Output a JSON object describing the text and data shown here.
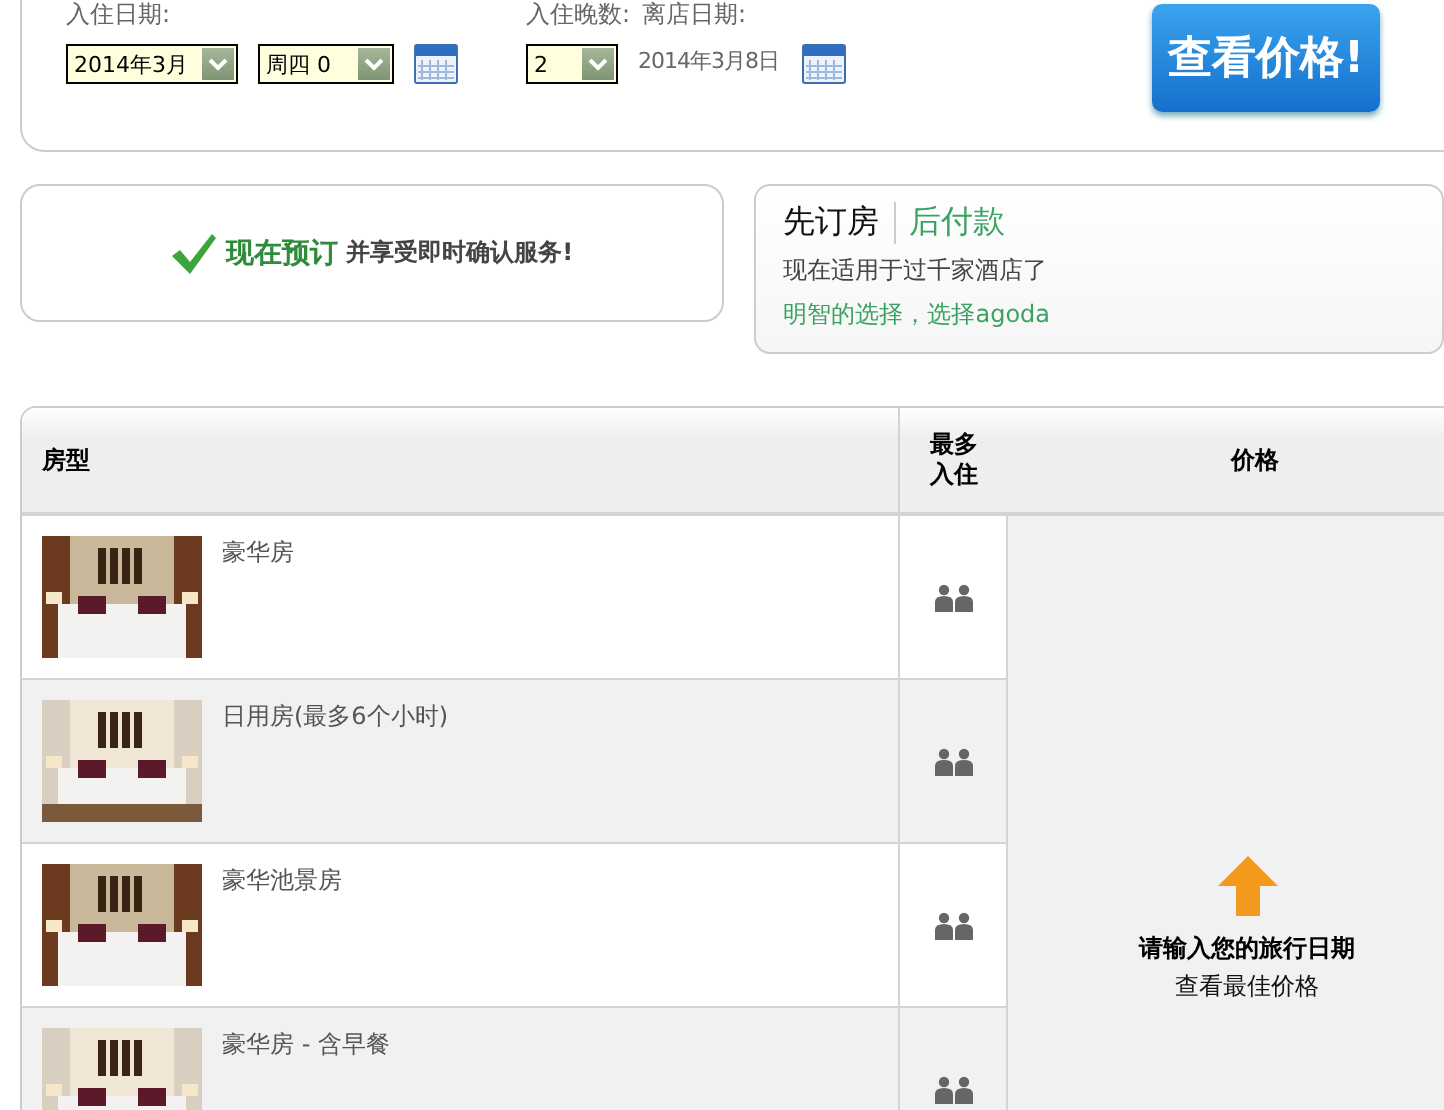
{
  "search": {
    "checkin_label": "入住日期:",
    "checkin_month": {
      "value": "2014年3月"
    },
    "checkin_day": {
      "value": "周四 0"
    },
    "nights_label": "入住晚数:",
    "nights": {
      "value": "2"
    },
    "checkout_label": "离店日期:",
    "checkout_date": "2014年3月8日",
    "button": "查看价格!"
  },
  "promo": {
    "highlight": "现在预订",
    "text": "并享受即时确认服务!"
  },
  "pay_later": {
    "title": "先订房",
    "title_accent": "后付款",
    "line": "现在适用于过千家酒店了",
    "tagline": "明智的选择，选择agoda"
  },
  "table": {
    "columns": [
      "房型",
      "最多入住",
      "价格"
    ],
    "rows": [
      {
        "name": "豪华房"
      },
      {
        "name": "日用房(最多6个小时)"
      },
      {
        "name": "豪华池景房"
      },
      {
        "name": "豪华房 - 含早餐"
      }
    ],
    "price_prompt": {
      "title": "请输入您的旅行日期",
      "subtitle": "查看最佳价格"
    }
  }
}
